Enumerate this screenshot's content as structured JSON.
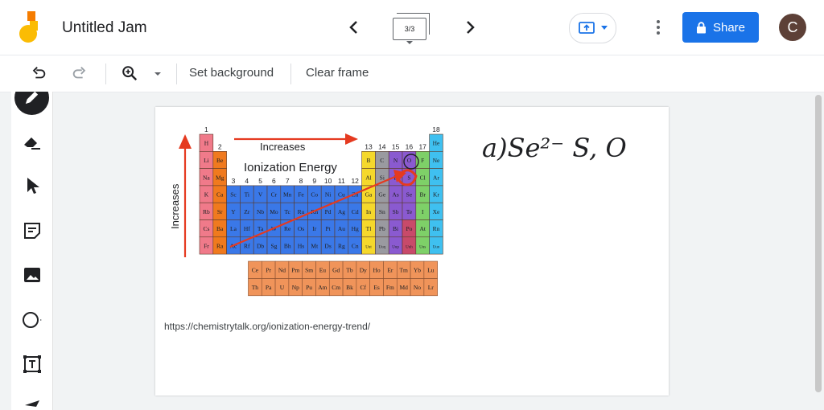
{
  "app": {
    "title": "Untitled Jam"
  },
  "frame": {
    "indicator": "3/3"
  },
  "header": {
    "share_label": "Share",
    "avatar_initial": "C"
  },
  "toolbar": {
    "set_background": "Set background",
    "clear_frame": "Clear frame"
  },
  "sidebar": {
    "tools": [
      "pen-icon",
      "eraser-icon",
      "select-icon",
      "sticky-note-icon",
      "image-icon",
      "circle-icon",
      "text-box-icon",
      "laser-icon"
    ]
  },
  "canvas": {
    "url_text": "https://chemistrytalk.org/ionization-energy-trend/",
    "image": {
      "increases_label": "Increases",
      "side_label": "Increases",
      "energy_label": "Ionization Energy",
      "group_numbers": [
        "1",
        "2",
        "3",
        "4",
        "5",
        "6",
        "7",
        "8",
        "9",
        "10",
        "11",
        "12",
        "13",
        "14",
        "15",
        "16",
        "17",
        "18"
      ],
      "rows": [
        [
          "H",
          "",
          "",
          "",
          "",
          "",
          "",
          "",
          "",
          "",
          "",
          "",
          "",
          "",
          "",
          "",
          "",
          "He"
        ],
        [
          "Li",
          "Be",
          "",
          "",
          "",
          "",
          "",
          "",
          "",
          "",
          "",
          "",
          "B",
          "C",
          "N",
          "O",
          "F",
          "Ne"
        ],
        [
          "Na",
          "Mg",
          "",
          "",
          "",
          "",
          "",
          "",
          "",
          "",
          "",
          "",
          "Al",
          "Si",
          "P",
          "S",
          "Cl",
          "Ar"
        ],
        [
          "K",
          "Ca",
          "Sc",
          "Ti",
          "V",
          "Cr",
          "Mn",
          "Fe",
          "Co",
          "Ni",
          "Cu",
          "Zn",
          "Ga",
          "Ge",
          "As",
          "Se",
          "Br",
          "Kr"
        ],
        [
          "Rb",
          "Sr",
          "Y",
          "Zr",
          "Nb",
          "Mo",
          "Tc",
          "Ru",
          "Rh",
          "Pd",
          "Ag",
          "Cd",
          "In",
          "Sn",
          "Sb",
          "Te",
          "I",
          "Xe"
        ],
        [
          "Cs",
          "Ba",
          "La",
          "Hf",
          "Ta",
          "W",
          "Re",
          "Os",
          "Ir",
          "Pt",
          "Au",
          "Hg",
          "Tl",
          "Pb",
          "Bi",
          "Po",
          "At",
          "Rn"
        ],
        [
          "Fr",
          "Ra",
          "Ac",
          "Rf",
          "Db",
          "Sg",
          "Bh",
          "Hs",
          "Mt",
          "Ds",
          "Rg",
          "Cn",
          "Uut",
          "Uuq",
          "Uup",
          "Uuh",
          "Uus",
          "Uuo"
        ]
      ],
      "lanthanides": [
        "Ce",
        "Pr",
        "Nd",
        "Pm",
        "Sm",
        "Eu",
        "Gd",
        "Tb",
        "Dy",
        "Ho",
        "Er",
        "Tm",
        "Yb",
        "Lu"
      ],
      "actinides": [
        "Th",
        "Pa",
        "U",
        "Np",
        "Pu",
        "Am",
        "Cm",
        "Bk",
        "Cf",
        "Es",
        "Fm",
        "Md",
        "No",
        "Lr"
      ]
    },
    "handwriting": "a)Se²⁻ S, O"
  },
  "colors": {
    "accent": "#1a73e8",
    "avatar": "#5d4037",
    "arrow": "#e53a20",
    "ink": "#202124"
  }
}
